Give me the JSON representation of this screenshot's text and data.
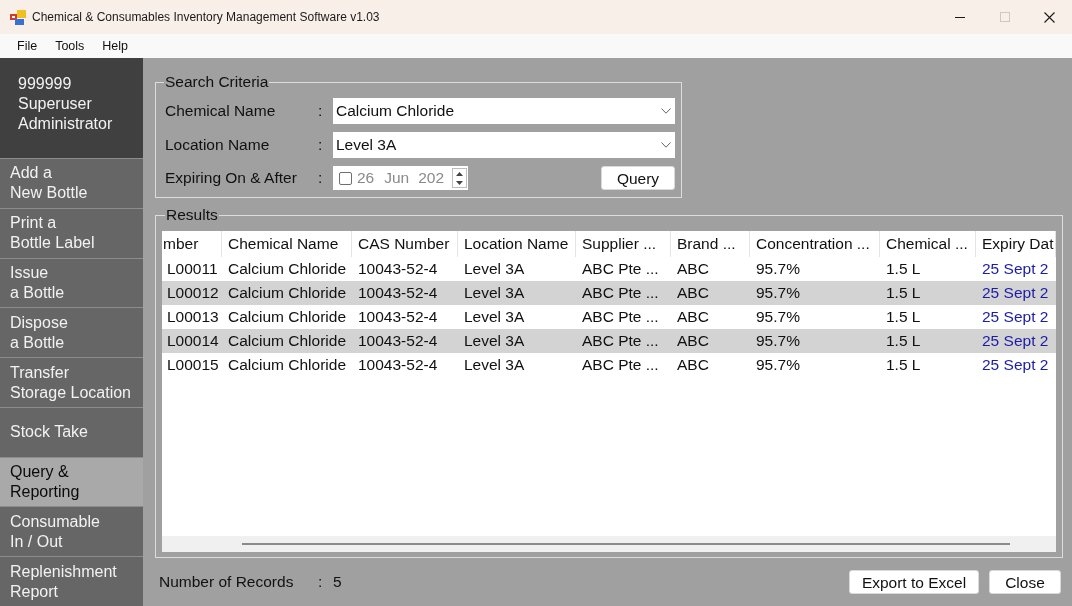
{
  "window": {
    "title": "Chemical & Consumables Inventory Management Software v1.03",
    "controls": [
      {
        "kind": "minimize",
        "disabled": false
      },
      {
        "kind": "maximize",
        "disabled": true
      },
      {
        "kind": "close",
        "disabled": false
      }
    ]
  },
  "menu": [
    "File",
    "Tools",
    "Help"
  ],
  "user": {
    "id": "999999",
    "name": "Superuser",
    "role": "Administrator"
  },
  "sidebar": {
    "items": [
      {
        "label": "Add a\nNew Bottle",
        "selected": false
      },
      {
        "label": "Print a\nBottle Label",
        "selected": false
      },
      {
        "label": "Issue\na Bottle",
        "selected": false
      },
      {
        "label": "Dispose\na Bottle",
        "selected": false
      },
      {
        "label": "Transfer\nStorage Location",
        "selected": false
      },
      {
        "label": "Stock Take",
        "selected": false
      },
      {
        "label": "Query &\nReporting",
        "selected": true
      },
      {
        "label": "Consumable\nIn / Out",
        "selected": false
      },
      {
        "label": "Replenishment\nReport",
        "selected": false
      }
    ]
  },
  "search_criteria": {
    "title": "Search Criteria",
    "fields": [
      {
        "kind": "combo",
        "label": "Chemical Name",
        "separator": ":",
        "value": "Calcium Chloride"
      },
      {
        "kind": "combo",
        "label": "Location Name",
        "separator": ":",
        "value": "Level 3A"
      },
      {
        "kind": "date",
        "label": "Expiring On & After",
        "separator": ":",
        "checked": false,
        "day": "26",
        "month": "Jun",
        "year": "202"
      }
    ],
    "query_button": "Query"
  },
  "results": {
    "title": "Results",
    "columns": [
      {
        "label": "mber",
        "kind": "text"
      },
      {
        "label": "Chemical Name",
        "kind": "text"
      },
      {
        "label": "CAS Number",
        "kind": "text"
      },
      {
        "label": "Location Name",
        "kind": "text"
      },
      {
        "label": "Supplier ...",
        "kind": "text"
      },
      {
        "label": "Brand ...",
        "kind": "text"
      },
      {
        "label": "Concentration ...",
        "kind": "text"
      },
      {
        "label": "Chemical ...",
        "kind": "text"
      },
      {
        "label": "Expiry Dat",
        "kind": "date"
      }
    ],
    "rows": [
      [
        "L00011",
        "Calcium Chloride",
        "10043-52-4",
        "Level 3A",
        "ABC Pte ...",
        "ABC",
        "95.7%",
        "1.5 L",
        "25 Sept 2"
      ],
      [
        "L00012",
        "Calcium Chloride",
        "10043-52-4",
        "Level 3A",
        "ABC Pte ...",
        "ABC",
        "95.7%",
        "1.5 L",
        "25 Sept 2"
      ],
      [
        "L00013",
        "Calcium Chloride",
        "10043-52-4",
        "Level 3A",
        "ABC Pte ...",
        "ABC",
        "95.7%",
        "1.5 L",
        "25 Sept 2"
      ],
      [
        "L00014",
        "Calcium Chloride",
        "10043-52-4",
        "Level 3A",
        "ABC Pte ...",
        "ABC",
        "95.7%",
        "1.5 L",
        "25 Sept 2"
      ],
      [
        "L00015",
        "Calcium Chloride",
        "10043-52-4",
        "Level 3A",
        "ABC Pte ...",
        "ABC",
        "95.7%",
        "1.5 L",
        "25 Sept 2"
      ]
    ]
  },
  "footer": {
    "label": "Number of Records",
    "separator": ":",
    "count": "5",
    "buttons": [
      "Export to Excel",
      "Close"
    ]
  }
}
